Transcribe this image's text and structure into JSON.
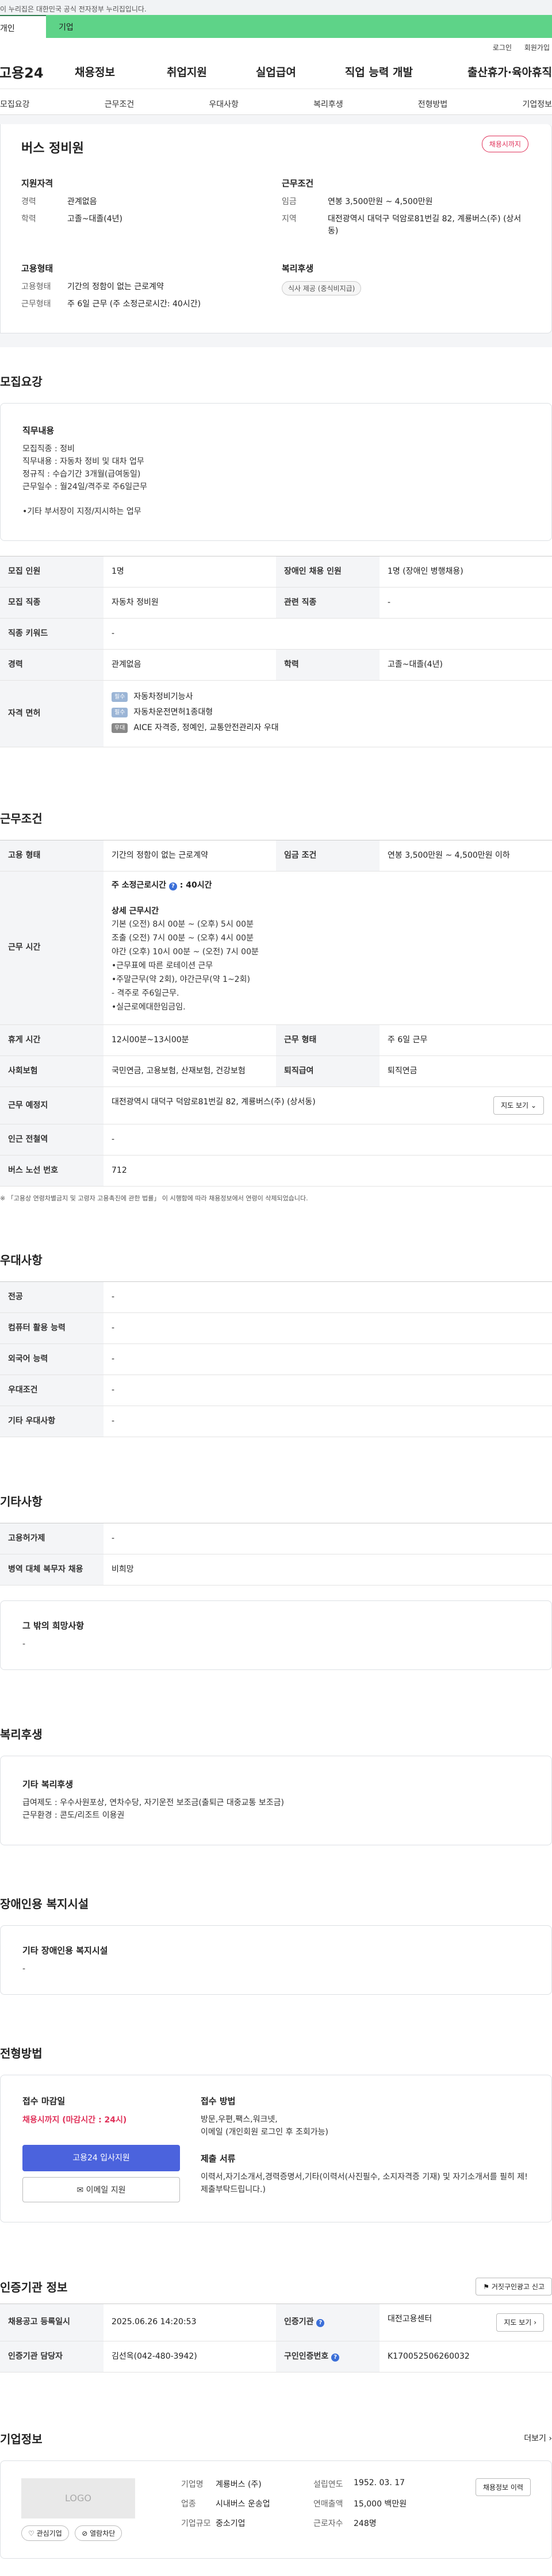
{
  "topline": {
    "text": "이 누리집은 대한민국 공식 전자정부 누리집입니다."
  },
  "tabs": [
    {
      "label": "개인"
    },
    {
      "label": "기업"
    }
  ],
  "util": {
    "login": "로그인",
    "signup": "회원가입"
  },
  "gnb": {
    "logo": "고용24",
    "menus": [
      "채용정보",
      "취업지원",
      "실업급여",
      "직업 능력 개발",
      "출산휴가·육아휴직"
    ]
  },
  "subnav": [
    "모집요강",
    "근무조건",
    "우대사항",
    "복리후생",
    "전형방법",
    "기업정보"
  ],
  "hero": {
    "title": "버스 정비원",
    "badge": "채용시까지",
    "qual_title": "지원자격",
    "career_k": "경력",
    "career_v": "관계없음",
    "edu_k": "학력",
    "edu_v": "고졸~대졸(4년)",
    "cond_title": "근무조건",
    "wage_k": "임금",
    "wage_v": "연봉 3,500만원 ~ 4,500만원",
    "area_k": "지역",
    "area_v": "대전광역시 대덕구 덕암로81번길 82, 계룡버스(주) (상서동)",
    "emp_title": "고용형태",
    "emptype_k": "고용형태",
    "emptype_v": "기간의 정함이 없는 근로계약",
    "worktype_k": "근무형태",
    "worktype_v": "주 6일 근무 (주 소정근로시간: 40시간)",
    "welfare_title": "복리후생",
    "welfare_chip": "식사 제공 (중식비지급)"
  },
  "recruit": {
    "title": "모집요강",
    "box_title": "직무내용",
    "box_text": "모집직종 : 정비\n직무내용 : 자동차 정비 및 대차 업무\n정규직 : 수습기간 3개월(급여동일)\n근무일수 : 월24일/격주로 주6일근무\n\n•기타 부서장이 지정/지시하는 업무",
    "rows": {
      "count_k": "모집 인원",
      "count_v": "1명",
      "disabled_k": "장애인 채용 인원",
      "disabled_v": "1명 (장애인 병행채용)",
      "job_k": "모집 직종",
      "job_v": "자동차 정비원",
      "related_k": "관련 직종",
      "related_v": "-",
      "keyword_k": "직종 키워드",
      "keyword_v": "-",
      "career_k": "경력",
      "career_v": "관계없음",
      "edu_k": "학력",
      "edu_v": "고졸~대졸(4년)",
      "license_k": "자격 면허",
      "licenses": [
        {
          "tag": "필수",
          "name": "자동차정비기능사"
        },
        {
          "tag": "필수",
          "name": "자동차운전면허1종대형"
        },
        {
          "tag": "우대",
          "name": "AICE 자격증, 정예인, 교통안전관리자 우대"
        }
      ]
    }
  },
  "work": {
    "title": "근무조건",
    "emp_k": "고용 형태",
    "emp_v": "기간의 정함이 없는 근로계약",
    "wage_k": "임금 조건",
    "wage_v": "연봉 3,500만원 ~ 4,500만원 이하",
    "time_k": "근무 시간",
    "time_head": "주 소정근로시간",
    "time_head_v": "40시간",
    "time_sub": "상세 근무시간",
    "time_lines": "기본 (오전) 8시 00분 ~ (오후) 5시 00분\n조출 (오전) 7시 00분 ~ (오후) 4시 00분\n야간 (오후) 10시 00분 ~ (오전) 7시 00분\n•근무표에 따른 로테이션 근무\n•주말근무(약 2회), 야간근무(약 1~2회)\n- 격주로 주6일근무.\n•실근로에대한임금임.",
    "break_k": "휴게 시간",
    "break_v": "12시00분~13시00분",
    "form_k": "근무 형태",
    "form_v": "주 6일 근무",
    "ins_k": "사회보험",
    "ins_v": "국민연금, 고용보험, 산재보험, 건강보험",
    "retire_k": "퇴직급여",
    "retire_v": "퇴직연금",
    "place_k": "근무 예정지",
    "place_v": "대전광역시 대덕구 덕암로81번길 82, 계룡버스(주) (상서동)",
    "map_btn": "지도 보기",
    "station_k": "인근 전철역",
    "station_v": "-",
    "bus_k": "버스 노선 번호",
    "bus_v": "712",
    "note": "※ 「고용상 연령차별금지 및 고령자 고용촉진에 관한 법률」 이 시행함에 따라 채용정보에서 연령이 삭제되었습니다."
  },
  "pref": {
    "title": "우대사항",
    "rows": [
      {
        "k": "전공",
        "v": "-"
      },
      {
        "k": "컴퓨터 활용 능력",
        "v": "-"
      },
      {
        "k": "외국어 능력",
        "v": "-"
      },
      {
        "k": "우대조건",
        "v": "-"
      },
      {
        "k": "기타 우대사항",
        "v": "-"
      }
    ]
  },
  "etc": {
    "title": "기타사항",
    "rows": [
      {
        "k": "고용허가제",
        "v": "-"
      },
      {
        "k": "병역 대체 복무자 채용",
        "v": "비희망"
      }
    ],
    "box_title": "그 밖의 희망사항",
    "box_text": "-"
  },
  "welfare": {
    "title": "복리후생",
    "box_title": "기타 복리후생",
    "box_text": "급여제도 : 우수사원포상, 연차수당, 자기운전 보조금(출퇴근 대중교통 보조금)\n근무환경 : 콘도/리조트 이용권"
  },
  "disabled": {
    "title": "장애인용 복지시설",
    "box_title": "기타 장애인용 복지시설",
    "box_text": "-"
  },
  "process": {
    "title": "전형방법",
    "deadline_title": "접수 마감일",
    "deadline_v": "채용시까지 (마감시간 : 24시)",
    "apply_btn": "고용24 입사지원",
    "email_btn": "이메일 지원",
    "method_title": "접수 방법",
    "method_v": "방문,우편,팩스,워크넷,\n이메일 (개인회원 로그인 후 조회가능)",
    "docs_title": "제출 서류",
    "docs_v": "이력서,자기소개서,경력증명서,기타(이력서(사진필수, 소지자격증 기재) 및 자기소개서를 필히 제! 제출부탁드립니다.)"
  },
  "cert": {
    "title": "인증기관 정보",
    "report_btn": "거짓구인광고 신고",
    "reg_k": "채용공고 등록일시",
    "reg_v": "2025.06.26 14:20:53",
    "org_k": "인증기관",
    "org_v": "대전고용센터",
    "map_btn": "지도 보기",
    "manager_k": "인증기관 담당자",
    "manager_v": "김선옥(042-480-3942)",
    "certno_k": "구인인증번호",
    "certno_v": "K170052506260032"
  },
  "company": {
    "title": "기업정보",
    "more": "더보기",
    "logo": "LOGO",
    "interest_btn": "관심기업",
    "block_btn": "열람차단",
    "name_k": "기업명",
    "name_v": "계룡버스 (주)",
    "est_k": "설립연도",
    "est_v": "1952. 03. 17",
    "industry_k": "업종",
    "industry_v": "시내버스 운송업",
    "sales_k": "연매출액",
    "sales_v": "15,000 백만원",
    "size_k": "기업규모",
    "size_v": "중소기업",
    "staff_k": "근로자수",
    "staff_v": "248명",
    "hist_btn": "채용정보 이력"
  }
}
